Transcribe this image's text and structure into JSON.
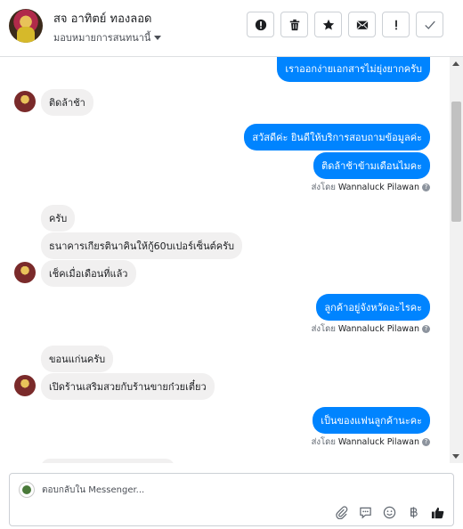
{
  "header": {
    "contact_name": "สจ อาทิตย์ ทองลอด",
    "assign_label": "มอบหมายการสนทนานี้",
    "tools": [
      {
        "name": "mark-spam-button",
        "icon": "alert-circle-icon"
      },
      {
        "name": "delete-button",
        "icon": "trash-icon"
      },
      {
        "name": "star-button",
        "icon": "star-icon"
      },
      {
        "name": "mark-unread-button",
        "icon": "envelope-icon"
      },
      {
        "name": "follow-up-button",
        "icon": "exclamation-icon"
      },
      {
        "name": "mark-done-button",
        "icon": "check-icon"
      }
    ]
  },
  "messages": {
    "m0": "เราออกง่ายเอกสารไม่ยุ่งยากครับ",
    "m1": "ติดล้าช้า",
    "m2": "สวัสดีค่ะ  ยินดีให้บริการสอบถามข้อมูลค่ะ",
    "m3": "ติดล้าช้าข้ามเดือนไมคะ",
    "m4": "ครับ",
    "m5": "ธนาคารเกียรตินาคินให้กู้60บเปอร์เซ็นต์ครับ",
    "m6": "เช็คเมื่อเดือนที่แล้ว",
    "m7": "ลูกค้าอยู่จังหวัดอะไรคะ",
    "m8": "ขอนแก่นครับ",
    "m9": "เปิดร้านเสริมสวยกับร้านขายก๋วยเตี๋ยว",
    "m10": "เป็นของแฟนลูกค้านะคะ"
  },
  "sent_by": {
    "prefix": "ส่งโดย",
    "agent": "Wannaluck Pilawan",
    "help": "?"
  },
  "composer": {
    "placeholder": "ตอบกลับใน Messenger..."
  },
  "colors": {
    "outgoing_bubble": "#0084ff",
    "incoming_bubble": "#f1f0f0",
    "like_icon": "#1c1e21"
  }
}
